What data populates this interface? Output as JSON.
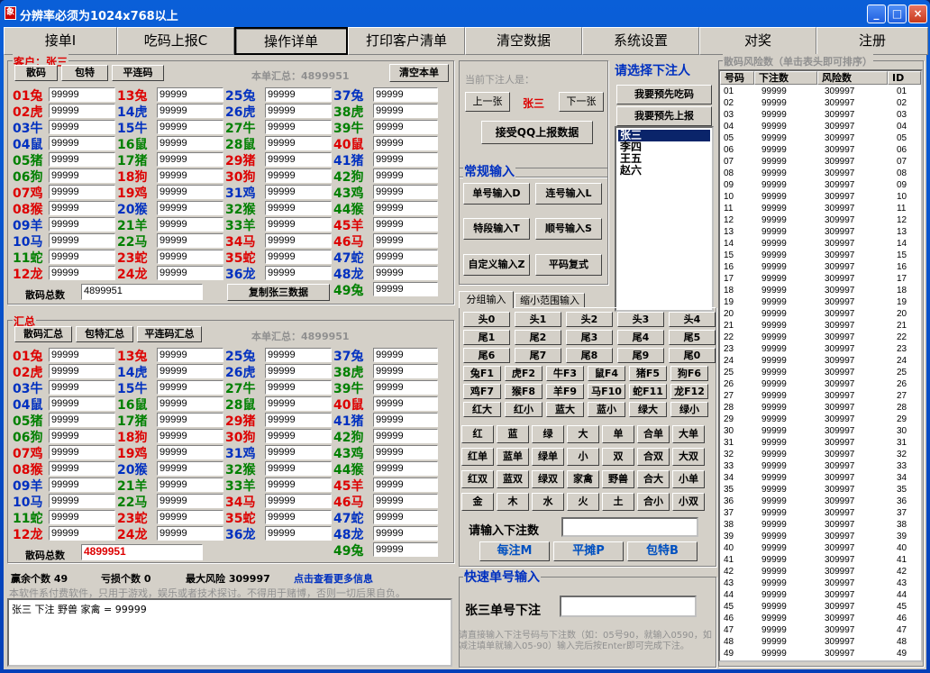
{
  "window": {
    "title": "分辨率必须为1024x768以上",
    "app_icon": "app-logo-icon",
    "min": "_",
    "max": "□",
    "close": "×"
  },
  "menu": [
    "接单I",
    "吃码上报C",
    "操作详单",
    "打印客户清单",
    "清空数据",
    "系统设置",
    "对奖",
    "注册"
  ],
  "top_panel": {
    "customer_label": "客户：张三",
    "btn_sanma": "散码",
    "btn_baote": "包特",
    "btn_pinglianma": "平连码",
    "summary": "本单汇总：4899951",
    "btn_clear": "清空本单",
    "total_label": "散码总数",
    "total_value": "4899951",
    "copy_btn": "复制张三数据"
  },
  "zodiac_rows": [
    [
      "01兔",
      "13兔",
      "25兔",
      "37兔"
    ],
    [
      "02虎",
      "14虎",
      "26虎",
      "38虎"
    ],
    [
      "03牛",
      "15牛",
      "27牛",
      "39牛"
    ],
    [
      "04鼠",
      "16鼠",
      "28鼠",
      "40鼠"
    ],
    [
      "05猪",
      "17猪",
      "29猪",
      "41猪"
    ],
    [
      "06狗",
      "18狗",
      "30狗",
      "42狗"
    ],
    [
      "07鸡",
      "19鸡",
      "31鸡",
      "43鸡"
    ],
    [
      "08猴",
      "20猴",
      "32猴",
      "44猴"
    ],
    [
      "09羊",
      "21羊",
      "33羊",
      "45羊"
    ],
    [
      "10马",
      "22马",
      "34马",
      "46马"
    ],
    [
      "11蛇",
      "23蛇",
      "35蛇",
      "47蛇"
    ],
    [
      "12龙",
      "24龙",
      "36龙",
      "48龙"
    ]
  ],
  "zodiac_extra": "49兔",
  "cell_value": "99999",
  "colors": {
    "red": "#d00000",
    "blue": "#0030c0",
    "green": "#008000"
  },
  "bottom_panel": {
    "label": "汇总",
    "btn_sanma": "散码汇总",
    "btn_baote": "包特汇总",
    "btn_pinglianma": "平连码汇总",
    "summary": "本单汇总：4899951",
    "total_label": "散码总数",
    "total_value": "4899951"
  },
  "status": {
    "win_count": "赢余个数 49",
    "loss_count": "亏损个数 0",
    "max_risk": "最大风险 309997",
    "more": "点击查看更多信息",
    "disclaimer": "本软件系付费软件，只用于游戏，娱乐或者技术探讨。不得用于赌博，否则一切后果自负。",
    "log": "张三 下注 野兽 家禽 = 99999"
  },
  "middle": {
    "current_label": "当前下注人是：",
    "prev": "上一张",
    "current_name": "张三",
    "next": "下一张",
    "qq_btn": "接受QQ上报数据",
    "select_title": "请选择下注人",
    "first_eat": "我要预先吃码",
    "first_report": "我要预先上报",
    "people": [
      "张三",
      "李四",
      "王五",
      "赵六"
    ]
  },
  "normal_input": {
    "title": "常规输入",
    "b1": "单号输入D",
    "b2": "连号输入L",
    "b3": "特段输入T",
    "b4": "顺号输入S",
    "b5": "自定义输入Z",
    "b6": "平码复式"
  },
  "tabs": [
    "分组输入",
    "缩小范围输入"
  ],
  "groups": [
    [
      "头0",
      "头1",
      "头2",
      "头3",
      "头4"
    ],
    [
      "尾1",
      "尾2",
      "尾3",
      "尾4",
      "尾5"
    ],
    [
      "尾6",
      "尾7",
      "尾8",
      "尾9",
      "尾0"
    ],
    [
      "兔F1",
      "虎F2",
      "牛F3",
      "鼠F4",
      "猪F5",
      "狗F6"
    ],
    [
      "鸡F7",
      "猴F8",
      "羊F9",
      "马F10",
      "蛇F11",
      "龙F12"
    ],
    [
      "红大",
      "红小",
      "蓝大",
      "蓝小",
      "绿大",
      "绿小"
    ]
  ],
  "groups2": [
    [
      "红",
      "蓝",
      "绿",
      "大",
      "单",
      "合单",
      "大单"
    ],
    [
      "红单",
      "蓝单",
      "绿单",
      "小",
      "双",
      "合双",
      "大双"
    ],
    [
      "红双",
      "蓝双",
      "绿双",
      "家禽",
      "野兽",
      "合大",
      "小单"
    ],
    [
      "金",
      "木",
      "水",
      "火",
      "土",
      "合小",
      "小双"
    ]
  ],
  "bet": {
    "label": "请输入下注数",
    "btn1": "每注M",
    "btn2": "平摊P",
    "btn3": "包特B"
  },
  "quick": {
    "title": "快速单号输入",
    "label": "张三单号下注",
    "hint": "请直接输入下注号码与下注数（如：05号90，就输入0590，如减注填单就输入05-90）输入完后按Enter即可完成下注。"
  },
  "risk": {
    "title": "散码风险数（单击表头即可排序）",
    "headers": [
      "号码",
      "下注数",
      "风险数",
      "ID"
    ],
    "bet": "99999",
    "risk_value": "309997"
  }
}
